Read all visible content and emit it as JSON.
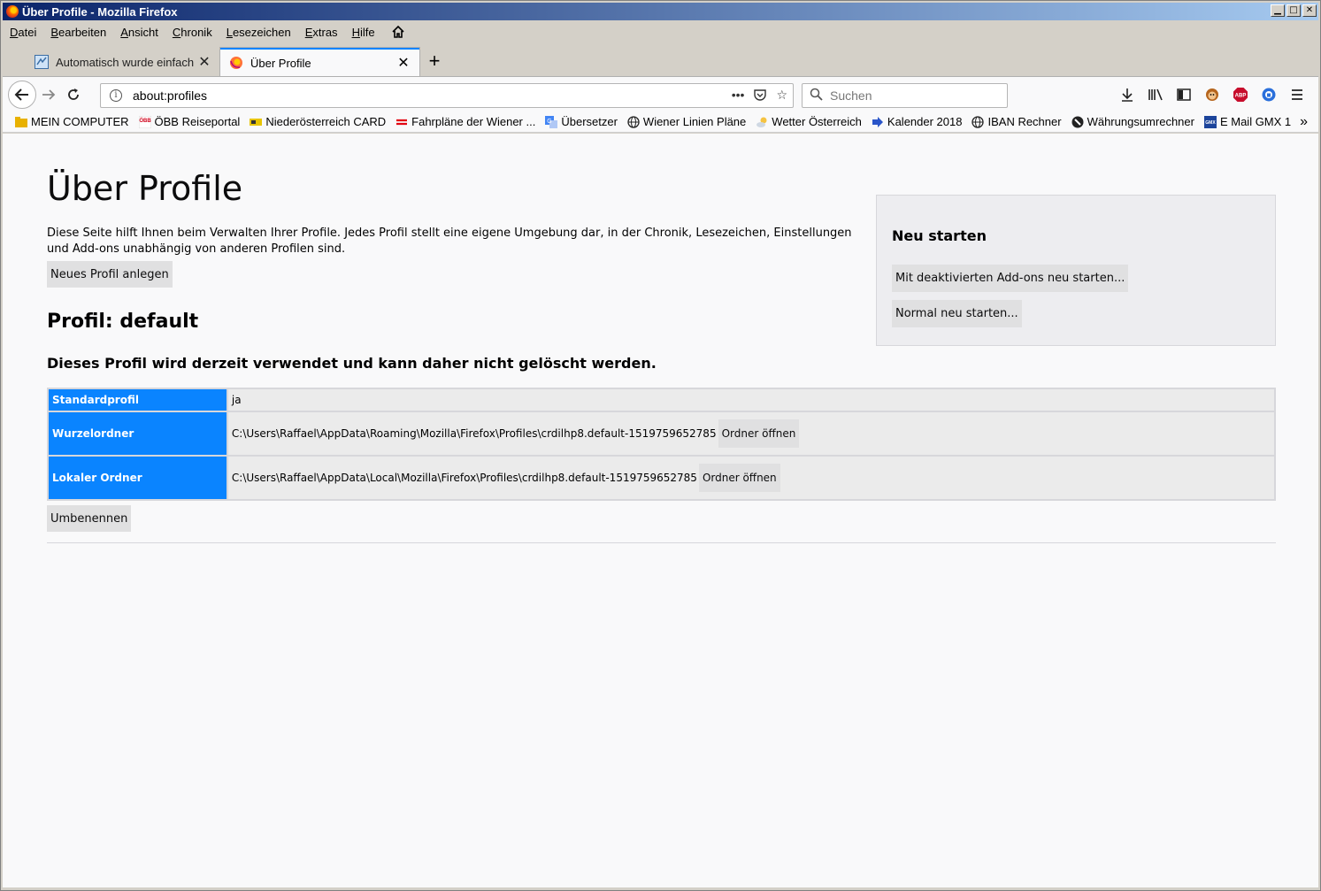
{
  "window": {
    "title": "Über Profile - Mozilla Firefox",
    "controls": [
      "minimize",
      "maximize",
      "close"
    ]
  },
  "menubar": {
    "items": [
      {
        "label": "Datei",
        "accel": "D",
        "rest": "atei"
      },
      {
        "label": "Bearbeiten",
        "accel": "B",
        "rest": "earbeiten"
      },
      {
        "label": "Ansicht",
        "accel": "A",
        "rest": "nsicht"
      },
      {
        "label": "Chronik",
        "accel": "C",
        "rest": "hronik"
      },
      {
        "label": "Lesezeichen",
        "accel": "L",
        "rest": "esezeichen"
      },
      {
        "label": "Extras",
        "accel": "E",
        "rest": "xtras"
      },
      {
        "label": "Hilfe",
        "accel": "H",
        "rest": "ilfe"
      }
    ]
  },
  "tabs": [
    {
      "label": "Automatisch wurde einfach a",
      "active": false
    },
    {
      "label": "Über Profile",
      "active": true
    }
  ],
  "navbar": {
    "url": "about:profiles",
    "search_placeholder": "Suchen"
  },
  "bookmarks": [
    {
      "label": "MEIN COMPUTER",
      "icon": "folder-icon",
      "color": "#e8b100"
    },
    {
      "label": "ÖBB Reiseportal",
      "icon": "oebb-icon",
      "color": "#d0021b"
    },
    {
      "label": "Niederösterreich CARD",
      "icon": "card-icon",
      "color": "#e8c400"
    },
    {
      "label": "Fahrpläne der Wiener ...",
      "icon": "wienerlinien-icon",
      "color": "#e20613"
    },
    {
      "label": "Übersetzer",
      "icon": "translate-icon",
      "color": "#4285f4"
    },
    {
      "label": "Wiener Linien Pläne",
      "icon": "globe-icon",
      "color": "#222222"
    },
    {
      "label": "Wetter Österreich",
      "icon": "weather-icon",
      "color": "#f5c342"
    },
    {
      "label": "Kalender 2018",
      "icon": "arrow-icon",
      "color": "#2a55c9"
    },
    {
      "label": "IBAN Rechner",
      "icon": "globe-icon",
      "color": "#222222"
    },
    {
      "label": "Währungsumrechner",
      "icon": "currency-icon",
      "color": "#222222"
    },
    {
      "label": "E Mail GMX 1",
      "icon": "gmx-icon",
      "color": "#1c449b"
    }
  ],
  "page": {
    "title": "Über Profile",
    "description": "Diese Seite hilft Ihnen beim Verwalten Ihrer Profile. Jedes Profil stellt eine eigene Umgebung dar, in der Chronik, Lesezeichen, Einstellungen und Add-ons unabhängig von anderen Profilen sind.",
    "new_profile_button": "Neues Profil anlegen",
    "restart": {
      "heading": "Neu starten",
      "no_addons_button": "Mit deaktivierten Add-ons neu starten...",
      "normal_button": "Normal neu starten..."
    },
    "profile": {
      "name": "Profil: default",
      "in_use_notice": "Dieses Profil wird derzeit verwendet und kann daher nicht gelöscht werden.",
      "rows": [
        {
          "label": "Standardprofil",
          "value": "ja"
        },
        {
          "label": "Wurzelordner",
          "value": "C:\\Users\\Raffael\\AppData\\Roaming\\Mozilla\\Firefox\\Profiles\\crdilhp8.default-1519759652785",
          "button": "Ordner öffnen"
        },
        {
          "label": "Lokaler Ordner",
          "value": "C:\\Users\\Raffael\\AppData\\Local\\Mozilla\\Firefox\\Profiles\\crdilhp8.default-1519759652785",
          "button": "Ordner öffnen"
        }
      ],
      "rename_button": "Umbenennen"
    }
  },
  "colors": {
    "accent": "#0a84ff",
    "titlebar_start": "#0a246a",
    "titlebar_end": "#a6caf0"
  }
}
